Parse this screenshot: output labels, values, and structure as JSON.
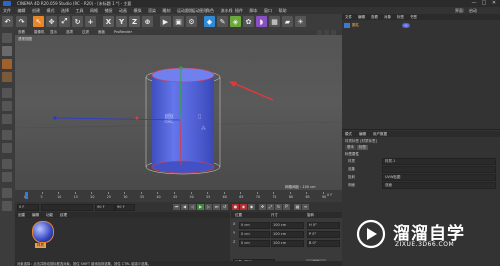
{
  "window": {
    "title": "CINEMA 4D R20.059 Studio (RC - R20) - [未标题 1 *] - 主要",
    "controls": [
      "—",
      "□",
      "✕"
    ]
  },
  "menubar": {
    "items": [
      "文件",
      "编辑",
      "创建",
      "模式",
      "选择",
      "工具",
      "网格",
      "捕捉",
      "动画",
      "模拟",
      "渲染",
      "雕刻",
      "运动跟踪",
      "运动图形",
      "角色",
      "流水线",
      "插件",
      "脚本",
      "窗口",
      "帮助"
    ],
    "right": [
      "界面:",
      "启动"
    ]
  },
  "toolbar": {
    "axes": [
      "X",
      "Y",
      "Z"
    ]
  },
  "viewport": {
    "menu": [
      "查看",
      "摄像机",
      "显示",
      "选项",
      "过滤",
      "面板",
      "ProRender"
    ],
    "label": "透视视图",
    "grid_info": "网格间距 : 100 cm"
  },
  "timeline": {
    "ticks": [
      "0",
      "5",
      "10",
      "15",
      "20",
      "25",
      "30",
      "35",
      "40",
      "45",
      "50",
      "55",
      "60",
      "65",
      "70",
      "75",
      "80",
      "85",
      "90"
    ],
    "frame_right": "0 F",
    "start": "0 F",
    "end_a": "90 F",
    "end_b": "90 F"
  },
  "material": {
    "menu": [
      "创建",
      "编辑",
      "功能",
      "纹理"
    ],
    "item_label": "材质"
  },
  "coords": {
    "headers": [
      "位置",
      "尺寸",
      "旋转"
    ],
    "rows": [
      {
        "axis": "X",
        "pos": "0 cm",
        "size": "100 cm",
        "rot": "H 0°"
      },
      {
        "axis": "Y",
        "pos": "0 cm",
        "size": "100 cm",
        "rot": "P 0°"
      },
      {
        "axis": "Z",
        "pos": "0 cm",
        "size": "100 cm",
        "rot": "B 0°"
      }
    ],
    "mode": "对象 (相对)",
    "apply": "应用"
  },
  "right": {
    "obj_tabs": [
      "文件",
      "编辑",
      "查看",
      "对象",
      "标签",
      "书签"
    ],
    "obj_name": "圆柱",
    "attr_tabs": [
      "模式",
      "编辑",
      "用户数据"
    ],
    "attr_title": "材质标签 [材质标签]",
    "sub_tabs": [
      "基本",
      "标签"
    ],
    "section": "标签属性",
    "rows": [
      {
        "label": "材质",
        "value": "材质.1"
      },
      {
        "label": "选集",
        "value": ""
      },
      {
        "label": "投射",
        "value": "UVW贴图"
      },
      {
        "label": "侧面",
        "value": "双面"
      }
    ]
  },
  "watermark": {
    "title": "溜溜自学",
    "subtitle": "ZIXUE.3D66.COM"
  },
  "statusbar": {
    "text": "对象选择 : 点击并拖动鼠标框选对象。按住 SHIFT 键添加到选集，按住 CTRL 键减少选集。"
  },
  "colors": {
    "cylinder": "#5262d8",
    "selection_red": "#e03a3a",
    "accent_orange": "#e8872a"
  }
}
